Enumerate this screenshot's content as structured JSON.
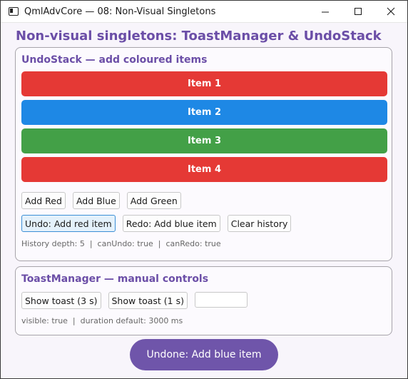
{
  "window": {
    "title": "QmlAdvCore — 08: Non-Visual Singletons"
  },
  "page": {
    "title": "Non-visual singletons: ToastManager & UndoStack"
  },
  "undo_panel": {
    "title": "UndoStack — add coloured items",
    "items": [
      {
        "label": "Item 1",
        "color": "#e53935"
      },
      {
        "label": "Item 2",
        "color": "#1e88e5"
      },
      {
        "label": "Item 3",
        "color": "#43a047"
      },
      {
        "label": "Item 4",
        "color": "#e53935"
      }
    ],
    "add_buttons": {
      "red": "Add Red",
      "blue": "Add Blue",
      "green": "Add Green"
    },
    "history_buttons": {
      "undo": "Undo: Add red item",
      "redo": "Redo: Add blue item",
      "clear": "Clear history"
    },
    "status": "History depth: 5  |  canUndo: true  |  canRedo: true"
  },
  "toast_panel": {
    "title": "ToastManager — manual controls",
    "buttons": {
      "show3": "Show toast (3 s)",
      "show1": "Show toast (1 s)"
    },
    "text_field_value": "",
    "status": "visible: true  |  duration default: 3000 ms"
  },
  "toast": {
    "message": "Undone: Add blue item",
    "color": "#6f55aa"
  },
  "colors": {
    "accent": "#6b4ea7"
  }
}
